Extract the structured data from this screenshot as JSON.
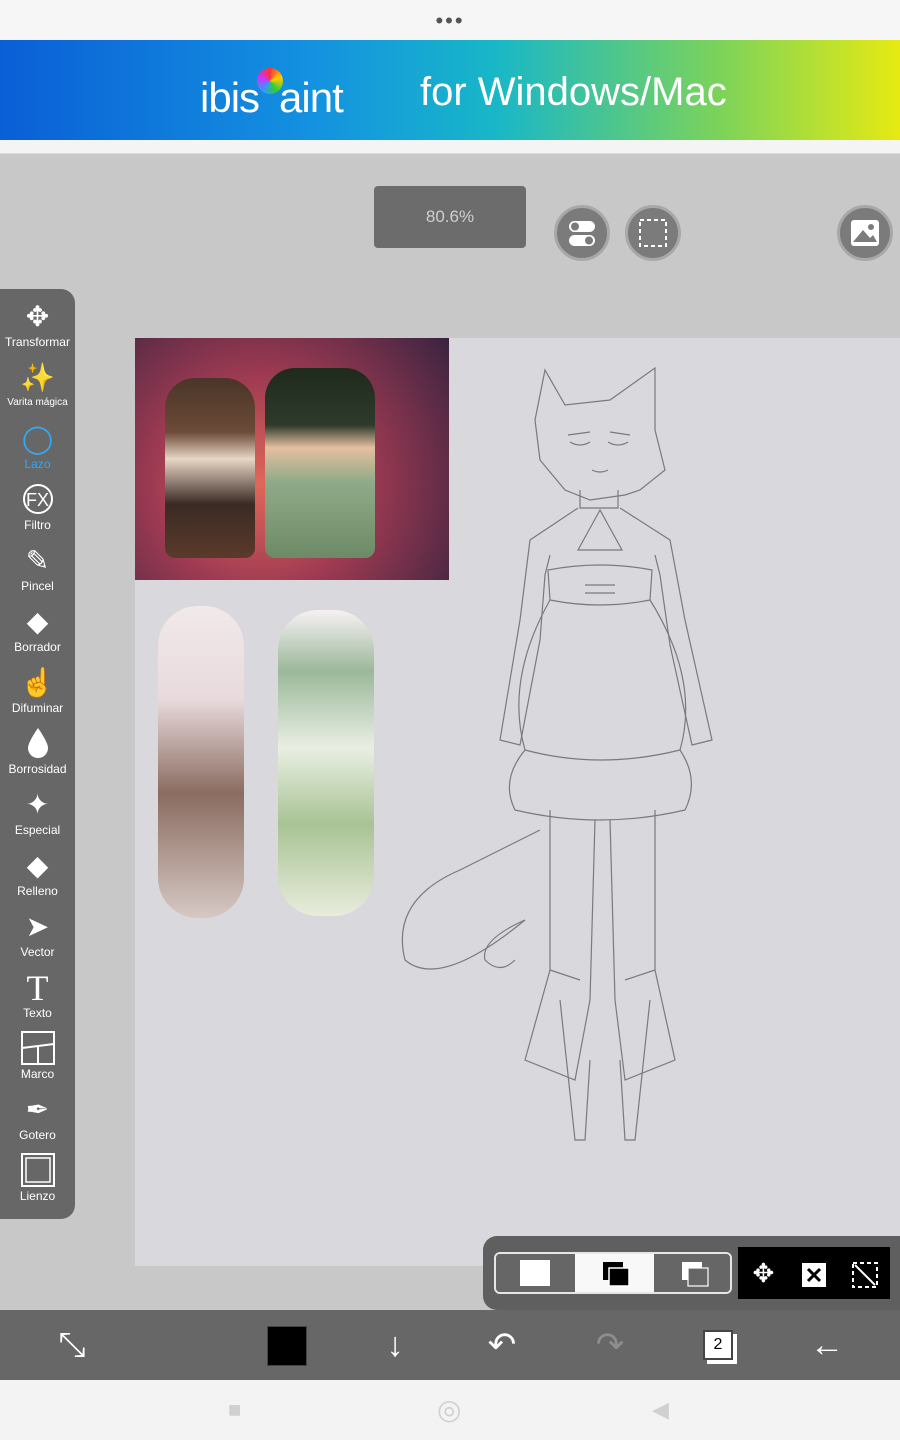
{
  "ad": {
    "logo_text_1": "ibis",
    "logo_text_2": "aint",
    "tagline": "for Windows/Mac"
  },
  "top_controls": {
    "zoom_label": "80.6%"
  },
  "toolbar": {
    "tools": [
      {
        "label": "Transformar",
        "icon": "move-arrows-icon",
        "glyph": "✥"
      },
      {
        "label": "Varita mágica",
        "icon": "magic-wand-icon",
        "glyph": "✨"
      },
      {
        "label": "Lazo",
        "icon": "lasso-icon",
        "glyph": "◯"
      },
      {
        "label": "Filtro",
        "icon": "fx-icon",
        "glyph": "FX"
      },
      {
        "label": "Pincel",
        "icon": "brush-icon",
        "glyph": "✎"
      },
      {
        "label": "Borrador",
        "icon": "eraser-icon",
        "glyph": "◆"
      },
      {
        "label": "Difuminar",
        "icon": "smudge-icon",
        "glyph": "☝"
      },
      {
        "label": "Borrosidad",
        "icon": "blur-drop-icon",
        "glyph": "💧"
      },
      {
        "label": "Especial",
        "icon": "special-pen-icon",
        "glyph": "✦"
      },
      {
        "label": "Relleno",
        "icon": "fill-bucket-icon",
        "glyph": "◆"
      },
      {
        "label": "Vector",
        "icon": "vector-arrow-icon",
        "glyph": "➤"
      },
      {
        "label": "Texto",
        "icon": "text-icon",
        "glyph": "T"
      },
      {
        "label": "Marco",
        "icon": "frame-icon",
        "glyph": "▦"
      },
      {
        "label": "Gotero",
        "icon": "eyedropper-icon",
        "glyph": "✒"
      },
      {
        "label": "Lienzo",
        "icon": "canvas-icon",
        "glyph": "▢"
      }
    ],
    "active_tool": "Lazo",
    "active_color": "#35a7f0"
  },
  "bottom_bar": {
    "layer_count": "2"
  },
  "colors": {
    "current_color": "#000000",
    "toolbar_bg": "#676767"
  }
}
